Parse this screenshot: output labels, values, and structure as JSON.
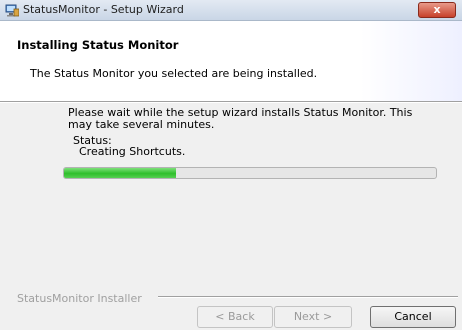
{
  "window": {
    "title": "StatusMonitor - Setup Wizard",
    "close_label": "x"
  },
  "banner": {
    "title": "Installing Status Monitor",
    "subtitle": "The Status Monitor you selected are being installed."
  },
  "main": {
    "message": "Please wait while the setup wizard installs Status Monitor. This may take several minutes.",
    "status_label": "Status:",
    "status_value": "Creating Shortcuts.",
    "progress_fraction": 0.3
  },
  "footer": {
    "installer_label": "StatusMonitor Installer",
    "back_label": "< Back",
    "next_label": "Next >",
    "cancel_label": "Cancel"
  },
  "colors": {
    "progress_fill": "#2fbf2b",
    "close_button": "#c7412b"
  },
  "icons": {
    "app": "installer-computer-icon",
    "close": "close-icon"
  }
}
